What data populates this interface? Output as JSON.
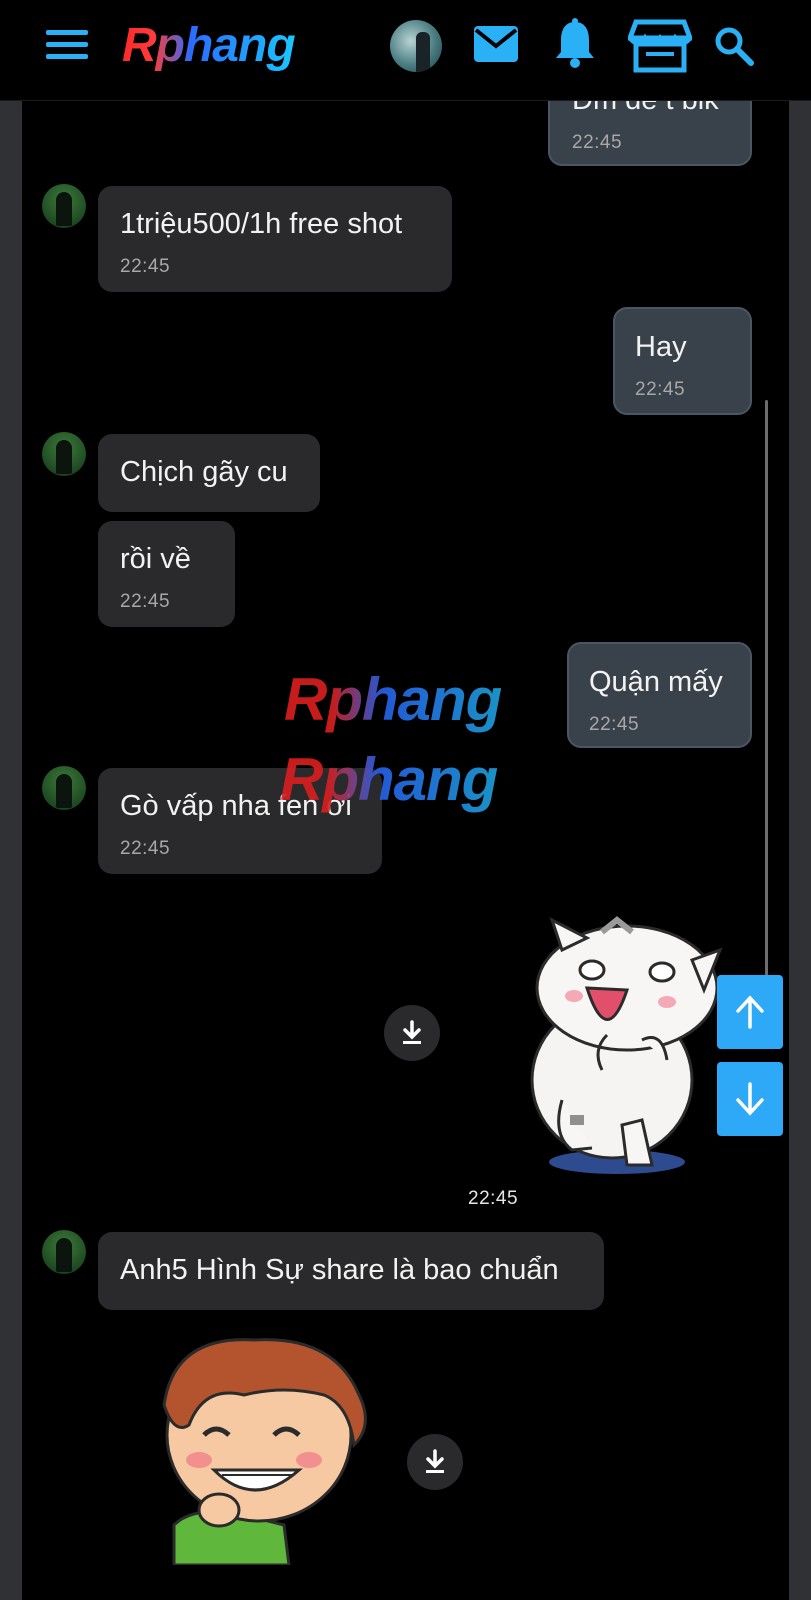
{
  "app": {
    "logo_text": "Rphang",
    "watermark_text": "Rphang"
  },
  "header": {
    "icons": [
      "menu-icon",
      "avatar",
      "mail-icon",
      "bell-icon",
      "store-icon",
      "search-icon"
    ]
  },
  "messages": [
    {
      "side": "out",
      "text": "Đm để t bik",
      "time": "22:45"
    },
    {
      "side": "in",
      "text": "1triệu500/1h free shot",
      "time": "22:45"
    },
    {
      "side": "out",
      "text": "Hay",
      "time": "22:45"
    },
    {
      "side": "in",
      "text": "Chịch gãy cu",
      "time": ""
    },
    {
      "side": "in",
      "text": "rồi về",
      "time": "22:45"
    },
    {
      "side": "out",
      "text": "Quận mấy",
      "time": "22:45"
    },
    {
      "side": "in",
      "text": "Gò vấp nha fen ơi",
      "time": "22:45"
    },
    {
      "side": "out",
      "type": "sticker",
      "sticker": "laughing-cat-sticker",
      "time": "22:45"
    },
    {
      "side": "in",
      "text": "Anh5 Hình Sự share là bao chuẩn",
      "time": ""
    },
    {
      "side": "in",
      "type": "sticker",
      "sticker": "grinning-boy-sticker",
      "time": ""
    }
  ],
  "colors": {
    "accent": "#2ea9f7",
    "incoming_bubble": "#2a2a2c",
    "outgoing_bubble": "#39414a"
  }
}
